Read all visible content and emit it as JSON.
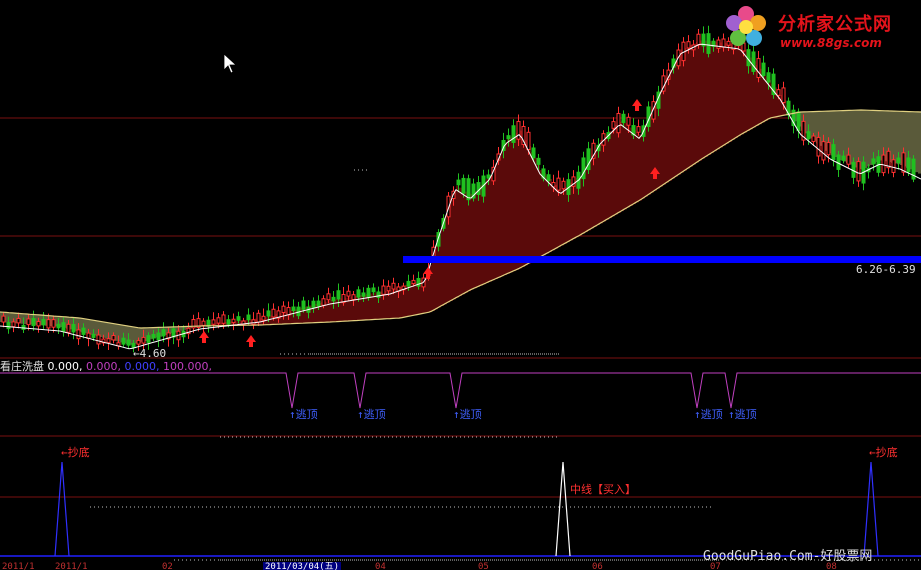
{
  "brand": {
    "title": "分析家公式网",
    "url": "www.88gs.com",
    "color": "#e3131b"
  },
  "price_panel": {
    "low_label": "4.60",
    "range_label": "6.26-6.39",
    "support_line_color": "#0000ff",
    "up_color": "#ff3030",
    "down_color": "#20c020",
    "ma_long_color": "#e0d080",
    "ma_short_color": "#ffffff",
    "fill_bull_color": "#5a0a0a",
    "fill_bear_color": "#5a5a3a"
  },
  "indicator": {
    "name": "看庄洗盘",
    "values": [
      "0.000,",
      "0.000,",
      "0.000,",
      "100.000,"
    ],
    "value_colors": [
      "#ffffff",
      "#c040c0",
      "#4040ff",
      "#c040c0"
    ],
    "signal_label": "逃顶",
    "signal_color": "#4060ff",
    "line_color": "#c040c0",
    "signals": [
      292,
      360,
      456,
      697,
      731
    ]
  },
  "bottom_panel": {
    "buy_bottom_label": "抄底",
    "mid_buy_label": "中线【买入】",
    "label_color": "#ff3030",
    "spike_color": "#3030ff"
  },
  "watermark": "GoodGuPiao.Com-好股票网",
  "xaxis": {
    "ticks": [
      "2011/1",
      "2011/1",
      "02",
      "2011/03/04(五)",
      "04",
      "05",
      "06",
      "07",
      "08"
    ],
    "selected_index": 3
  }
}
